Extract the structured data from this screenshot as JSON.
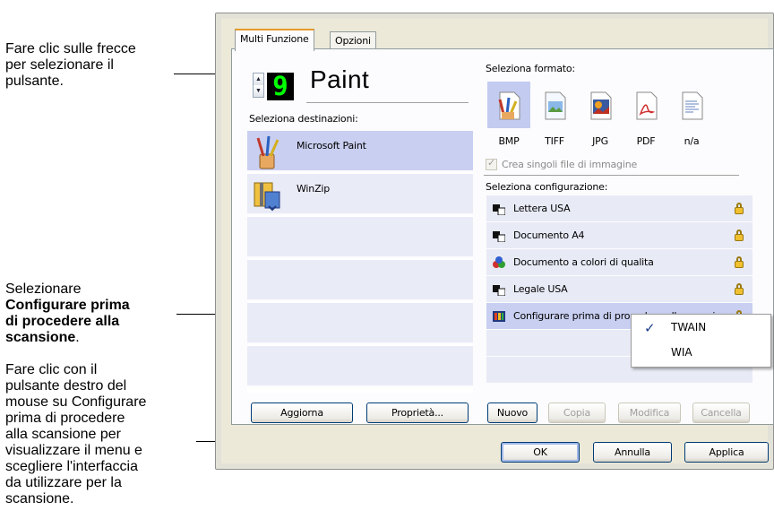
{
  "annotations": {
    "arrows": [
      "Fare clic sulle frecce",
      "per selezionare il",
      "pulsante."
    ],
    "select": [
      "Selezionare"
    ],
    "select_bold": [
      "Configurare prima",
      "di procedere alla",
      "scansione"
    ],
    "select_end": ".",
    "rightclick": [
      "Fare clic con il",
      "pulsante destro del",
      "mouse su Configurare",
      "prima di procedere",
      "alla scansione per",
      "visualizzare il menu e",
      "scegliere l'interfaccia",
      "da utilizzare per la",
      "scansione."
    ]
  },
  "tabs": [
    {
      "label": "Multi Funzione",
      "active": true
    },
    {
      "label": "Opzioni",
      "active": false
    }
  ],
  "spinner": {
    "digit": "9",
    "up_icon": "arrow-up-icon",
    "down_icon": "arrow-down-icon"
  },
  "button_name": "Paint",
  "destinations": {
    "label": "Seleziona destinazioni:",
    "items": [
      {
        "label": "Microsoft Paint",
        "icon": "paint-brushes-icon",
        "selected": true
      },
      {
        "label": "WinZip",
        "icon": "winzip-icon",
        "selected": false
      }
    ]
  },
  "format": {
    "label": "Seleziona formato:",
    "items": [
      {
        "label": "BMP",
        "icon": "bmp-file-icon",
        "selected": true
      },
      {
        "label": "TIFF",
        "icon": "tiff-file-icon",
        "selected": false
      },
      {
        "label": "JPG",
        "icon": "jpg-file-icon",
        "selected": false
      },
      {
        "label": "PDF",
        "icon": "pdf-file-icon",
        "selected": false
      },
      {
        "label": "n/a",
        "icon": "text-file-icon",
        "selected": false
      }
    ],
    "checkbox_label": "Crea singoli file di immagine",
    "checkbox_checked": true,
    "checkbox_disabled": true
  },
  "config": {
    "label": "Seleziona configurazione:",
    "items": [
      {
        "label": "Lettera USA",
        "icon": "bw-scan-icon",
        "locked": true
      },
      {
        "label": "Documento A4",
        "icon": "bw-scan-icon",
        "locked": true
      },
      {
        "label": "Documento a colori di qualita",
        "icon": "color-scan-icon",
        "locked": true
      },
      {
        "label": "Legale USA",
        "icon": "bw-scan-icon",
        "locked": true
      },
      {
        "label": "Configurare prima di procedere alla scansione",
        "icon": "configure-scan-icon",
        "locked": true,
        "selected": true
      }
    ]
  },
  "context_menu": {
    "items": [
      {
        "label": "TWAIN",
        "checked": true
      },
      {
        "label": "WIA",
        "checked": false
      }
    ]
  },
  "buttons": {
    "refresh": "Aggiorna",
    "properties": "Proprietà...",
    "new": "Nuovo",
    "copy": "Copia",
    "modify": "Modifica",
    "delete": "Cancella",
    "ok": "OK",
    "cancel": "Annulla",
    "apply": "Applica"
  },
  "colors": {
    "lcd_digit": "#00ff00",
    "selection": "#c9cff0",
    "tab_highlight": "#e69a2d"
  }
}
